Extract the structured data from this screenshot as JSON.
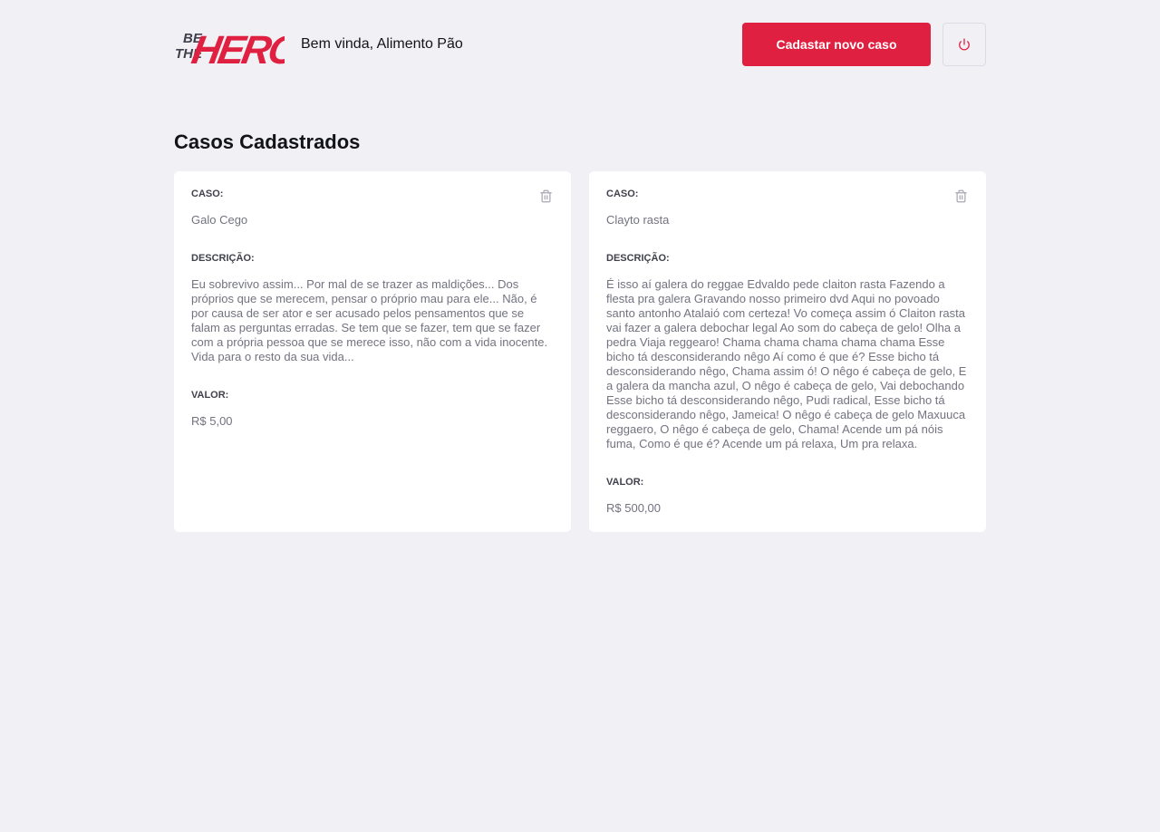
{
  "header": {
    "logo_alt": "BE THE HERO",
    "logo_line1": "BE",
    "logo_line2": "THE",
    "logo_word": "HERO",
    "welcome": "Bem vinda, Alimento Pão",
    "new_case_label": "Cadastar novo caso",
    "logout_icon": "power-icon"
  },
  "page": {
    "title": "Casos Cadastrados"
  },
  "labels": {
    "case": "CASO:",
    "description": "DESCRIÇÃO:",
    "value": "VALOR:"
  },
  "cases": [
    {
      "title": "Galo Cego",
      "description": "Eu sobrevivo assim... Por mal de se trazer as maldições... Dos próprios que se merecem, pensar o próprio mau para ele... Não, é por causa de ser ator e ser acusado pelos pensamentos que se falam as perguntas erradas. Se tem que se fazer, tem que se fazer com a própria pessoa que se merece isso, não com a vida inocente. Vida para o resto da sua vida...",
      "value": "R$ 5,00"
    },
    {
      "title": "Clayto rasta",
      "description": "É isso aí galera do reggae Edvaldo pede claiton rasta Fazendo a flesta pra galera Gravando nosso primeiro dvd Aqui no povoado santo antonho Atalaió com certeza! Vo começa assim ó Claiton rasta vai fazer a galera debochar legal Ao som do cabeça de gelo! Olha a pedra Viaja reggearo! Chama chama chama chama chama Esse bicho tá desconsiderando nêgo Aí como é que é? Esse bicho tá desconsiderando nêgo, Chama assim ó! O nêgo é cabeça de gelo, E a galera da mancha azul, O nêgo é cabeça de gelo, Vai debochando Esse bicho tá desconsiderando nêgo, Pudi radical, Esse bicho tá desconsiderando nêgo, Jameica! O nêgo é cabeça de gelo Maxuuca reggaero, O nêgo é cabeça de gelo, Chama! Acende um pá nóis fuma, Como é que é? Acende um pá relaxa, Um pra relaxa.",
      "value": "R$ 500,00"
    }
  ],
  "colors": {
    "brand": "#e02041",
    "background": "#f0f0f5",
    "dark": "#13131a",
    "muted": "#737380"
  },
  "icons": {
    "delete": "trash-icon",
    "logout": "power-icon"
  }
}
